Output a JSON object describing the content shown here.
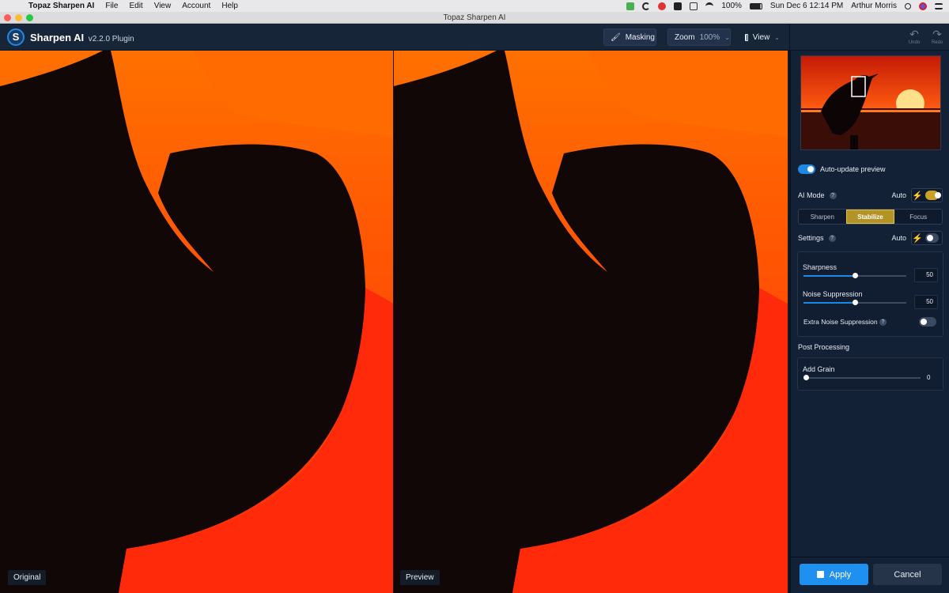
{
  "menubar": {
    "app_name": "Topaz Sharpen AI",
    "menus": [
      "File",
      "Edit",
      "View",
      "Account",
      "Help"
    ],
    "battery": "100%",
    "datetime": "Sun Dec 6  12:14 PM",
    "user": "Arthur Morris"
  },
  "window": {
    "title": "Topaz Sharpen AI"
  },
  "toolbar": {
    "brand": "Sharpen AI",
    "version": "v2.2.0 Plugin",
    "masking_label": "Masking",
    "zoom_label": "Zoom",
    "zoom_value": "100%",
    "view_label": "View",
    "undo_label": "Undo",
    "redo_label": "Redo"
  },
  "canvas": {
    "left_label": "Original",
    "right_label": "Preview",
    "colors": {
      "sky": "#ff6a00",
      "sun": "#ff2a0a",
      "silhouette": "#120707"
    }
  },
  "panel": {
    "auto_update_label": "Auto-update preview",
    "auto_update_on": true,
    "ai_mode_label": "AI Mode",
    "auto_label": "Auto",
    "modes": [
      "Sharpen",
      "Stabilize",
      "Focus"
    ],
    "active_mode": "Stabilize",
    "settings_label": "Settings",
    "sharpness_label": "Sharpness",
    "sharpness_value": "50",
    "sharpness_level": 0.5,
    "noise_label": "Noise Suppression",
    "noise_value": "50",
    "noise_level": 0.5,
    "extra_noise_label": "Extra Noise Suppression",
    "extra_noise_on": false,
    "post_processing_label": "Post Processing",
    "grain_label": "Add Grain",
    "grain_value": "0",
    "grain_level": 0.0,
    "apply_label": "Apply",
    "cancel_label": "Cancel",
    "accent_color": "#1e90f0",
    "active_mode_color": "#b39325"
  }
}
